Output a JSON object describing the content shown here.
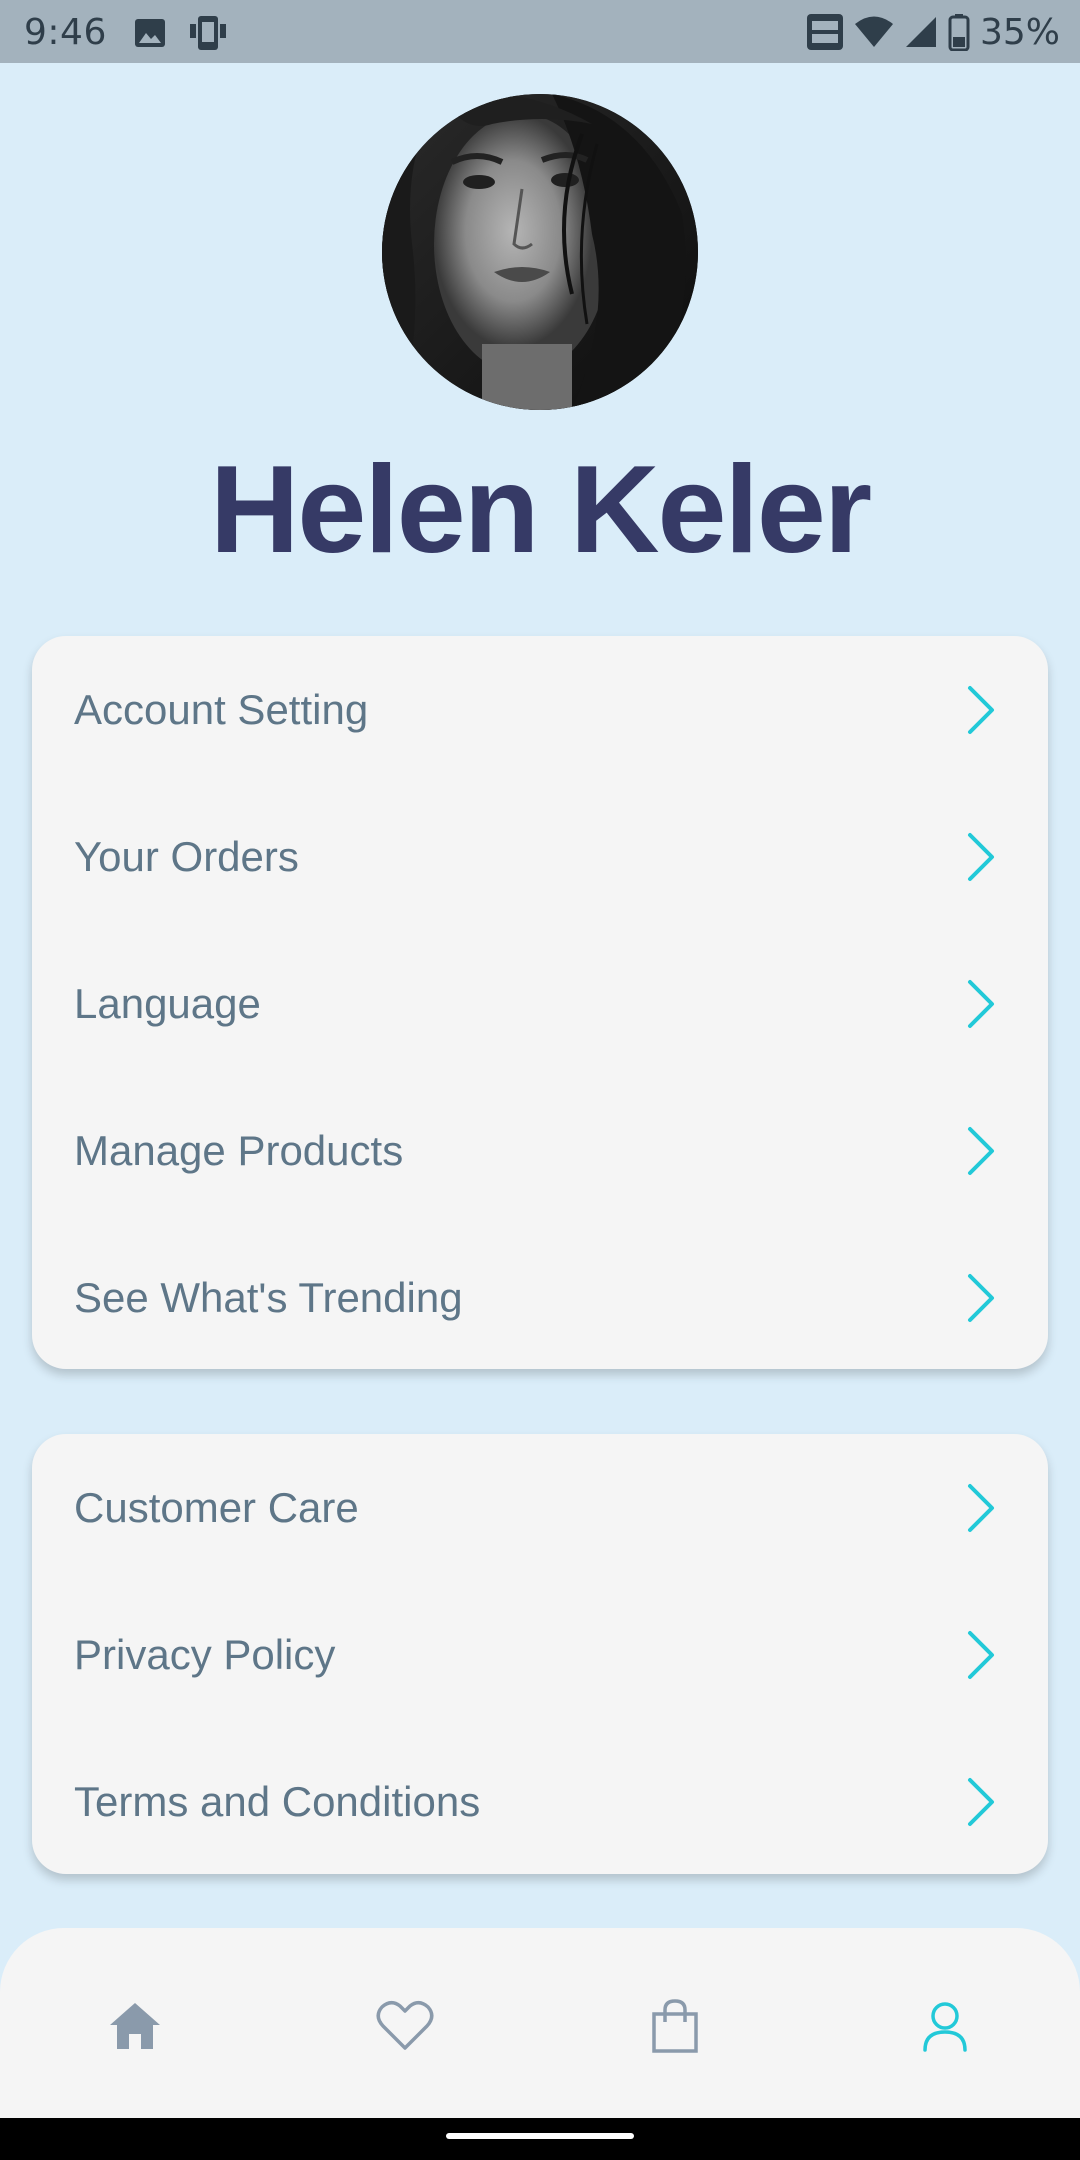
{
  "status_bar": {
    "time": "9:46",
    "battery": "35%"
  },
  "profile": {
    "name": "Helen Keler"
  },
  "menu_primary": [
    {
      "label": "Account Setting"
    },
    {
      "label": "Your Orders"
    },
    {
      "label": "Language"
    },
    {
      "label": "Manage Products"
    },
    {
      "label": "See What's Trending"
    }
  ],
  "menu_secondary": [
    {
      "label": "Customer Care"
    },
    {
      "label": "Privacy Policy"
    },
    {
      "label": "Terms and Conditions"
    }
  ],
  "bottom_nav": {
    "items": [
      {
        "icon": "home-icon",
        "active": false
      },
      {
        "icon": "heart-icon",
        "active": false
      },
      {
        "icon": "shopping-bag-icon",
        "active": false
      },
      {
        "icon": "user-icon",
        "active": true
      }
    ]
  },
  "colors": {
    "background": "#daedf9",
    "card": "#f5f5f5",
    "name_text": "#363a66",
    "menu_text": "#5e7688",
    "accent": "#22c9d8",
    "nav_inactive": "#8a9aab"
  }
}
